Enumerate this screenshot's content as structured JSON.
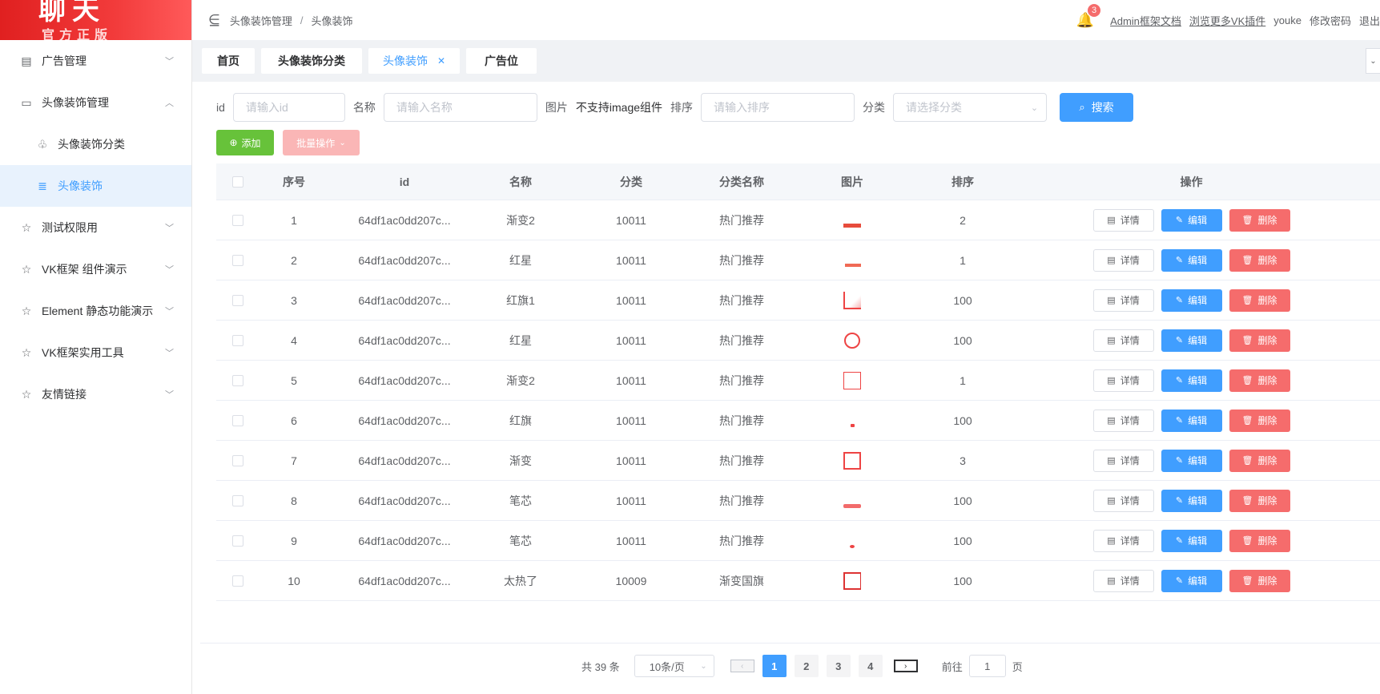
{
  "logo": {
    "line1": "聊天",
    "line2": "官方正版"
  },
  "sidebar": {
    "items": [
      {
        "label": "广告管理",
        "icon": "ad-icon",
        "expanded": false
      },
      {
        "label": "头像装饰管理",
        "icon": "folder-icon",
        "expanded": true
      },
      {
        "label": "头像装饰分类",
        "icon": "badge-icon",
        "sub": true
      },
      {
        "label": "头像装饰",
        "icon": "document-icon",
        "sub": true,
        "active": true
      },
      {
        "label": "测试权限用",
        "icon": "star-icon",
        "expanded": false
      },
      {
        "label": "VK框架 组件演示",
        "icon": "star-icon",
        "expanded": false
      },
      {
        "label": "Element 静态功能演示",
        "icon": "star-icon",
        "expanded": false
      },
      {
        "label": "VK框架实用工具",
        "icon": "star-icon",
        "expanded": false
      },
      {
        "label": "友情链接",
        "icon": "star-icon",
        "expanded": false
      }
    ]
  },
  "header": {
    "breadcrumb": [
      "头像装饰管理",
      "头像装饰"
    ],
    "notification_count": "3",
    "links": [
      "Admin框架文档",
      "浏览更多VK插件"
    ],
    "user": "youke",
    "change_password": "修改密码",
    "logout": "退出"
  },
  "tags": [
    "首页",
    "头像装饰分类",
    "头像装饰",
    "广告位"
  ],
  "tags_active_index": 2,
  "search": {
    "id_label": "id",
    "id_placeholder": "请输入id",
    "name_label": "名称",
    "name_placeholder": "请输入名称",
    "image_label": "图片",
    "image_note": "不支持image组件",
    "sort_label": "排序",
    "sort_placeholder": "请输入排序",
    "category_label": "分类",
    "category_placeholder": "请选择分类",
    "search_button": "搜索"
  },
  "actions": {
    "add": "添加",
    "batch": "批量操作"
  },
  "table": {
    "columns": [
      "序号",
      "id",
      "名称",
      "分类",
      "分类名称",
      "图片",
      "排序",
      "操作"
    ],
    "rows": [
      {
        "seq": "1",
        "id": "64df1ac0dd207c...",
        "name": "渐变2",
        "category": "10011",
        "category_name": "热门推荐",
        "sort": "2"
      },
      {
        "seq": "2",
        "id": "64df1ac0dd207c...",
        "name": "红星",
        "category": "10011",
        "category_name": "热门推荐",
        "sort": "1"
      },
      {
        "seq": "3",
        "id": "64df1ac0dd207c...",
        "name": "红旗1",
        "category": "10011",
        "category_name": "热门推荐",
        "sort": "100"
      },
      {
        "seq": "4",
        "id": "64df1ac0dd207c...",
        "name": "红星",
        "category": "10011",
        "category_name": "热门推荐",
        "sort": "100"
      },
      {
        "seq": "5",
        "id": "64df1ac0dd207c...",
        "name": "渐变2",
        "category": "10011",
        "category_name": "热门推荐",
        "sort": "1"
      },
      {
        "seq": "6",
        "id": "64df1ac0dd207c...",
        "name": "红旗",
        "category": "10011",
        "category_name": "热门推荐",
        "sort": "100"
      },
      {
        "seq": "7",
        "id": "64df1ac0dd207c...",
        "name": "渐变",
        "category": "10011",
        "category_name": "热门推荐",
        "sort": "3"
      },
      {
        "seq": "8",
        "id": "64df1ac0dd207c...",
        "name": "笔芯",
        "category": "10011",
        "category_name": "热门推荐",
        "sort": "100"
      },
      {
        "seq": "9",
        "id": "64df1ac0dd207c...",
        "name": "笔芯",
        "category": "10011",
        "category_name": "热门推荐",
        "sort": "100"
      },
      {
        "seq": "10",
        "id": "64df1ac0dd207c...",
        "name": "太热了",
        "category": "10009",
        "category_name": "渐变国旗",
        "sort": "100"
      }
    ],
    "op_labels": {
      "detail": "详情",
      "edit": "编辑",
      "delete": "删除"
    }
  },
  "pagination": {
    "total": "共 39 条",
    "page_size": "10条/页",
    "pages": [
      "1",
      "2",
      "3",
      "4"
    ],
    "current": "1",
    "goto_label": "前往",
    "goto_value": "1",
    "page_suffix": "页"
  },
  "colors": {
    "primary": "#409eff",
    "success": "#67c23a",
    "danger": "#f56c6c",
    "logo_red": "#e02020"
  }
}
